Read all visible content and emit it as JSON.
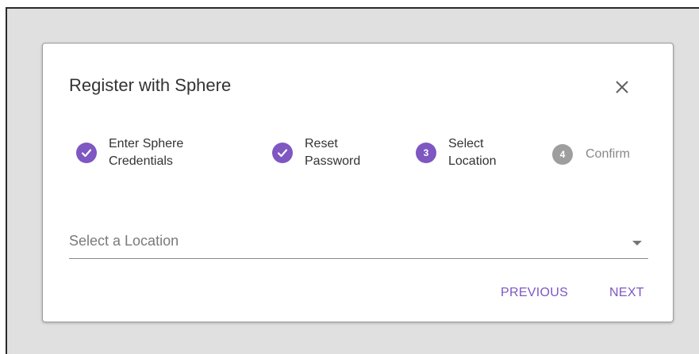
{
  "dialog": {
    "title": "Register with Sphere",
    "close_icon": "close-icon"
  },
  "stepper": {
    "steps": [
      {
        "label_line1": "Enter Sphere",
        "label_line2": "Credentials",
        "state": "completed",
        "icon": "check-icon"
      },
      {
        "label_line1": "Reset",
        "label_line2": "Password",
        "state": "completed",
        "icon": "check-icon"
      },
      {
        "number": "3",
        "label_line1": "Select",
        "label_line2": "Location",
        "state": "active"
      },
      {
        "number": "4",
        "label": "Confirm",
        "state": "pending"
      }
    ]
  },
  "location_select": {
    "placeholder": "Select a Location",
    "icon": "dropdown-arrow-icon"
  },
  "actions": {
    "previous_label": "PREVIOUS",
    "next_label": "NEXT"
  },
  "colors": {
    "accent": "#7e57c2",
    "pending": "#9e9e9e",
    "backdrop": "#e0e0e0"
  }
}
